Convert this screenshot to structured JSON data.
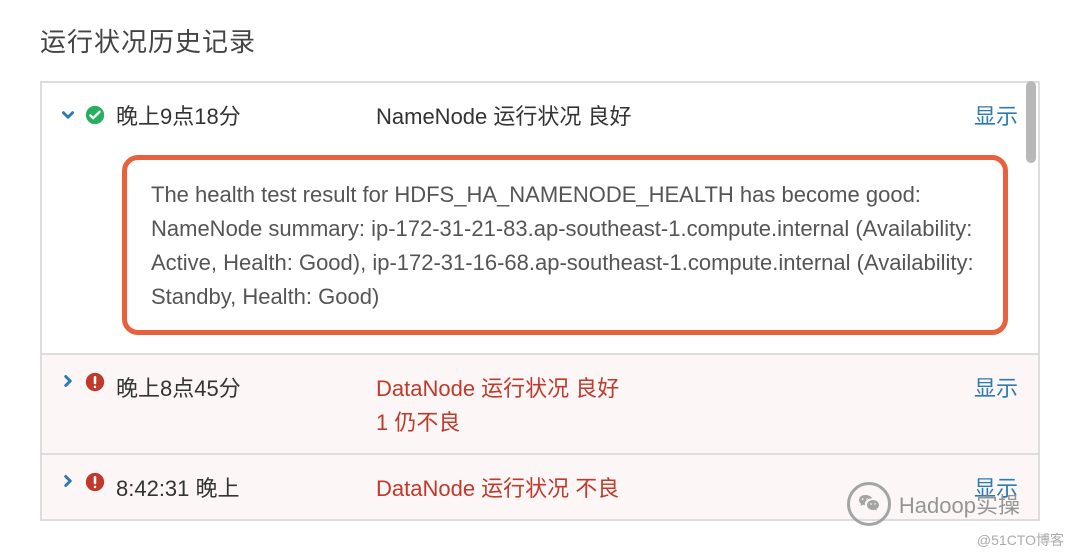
{
  "title": "运行状况历史记录",
  "rows": [
    {
      "time": "晚上9点18分",
      "status": "good",
      "msg": "NameNode 运行状况 良好",
      "action": "显示",
      "detail": "The health test result for HDFS_HA_NAMENODE_HEALTH has become good: NameNode summary: ip-172-31-21-83.ap-southeast-1.compute.internal (Availability: Active, Health: Good), ip-172-31-16-68.ap-southeast-1.compute.internal (Availability: Standby, Health: Good)"
    },
    {
      "time": "晚上8点45分",
      "status": "error",
      "msg": "DataNode 运行状况 良好",
      "msg2": "1 仍不良",
      "action": "显示"
    },
    {
      "time": "8:42:31 晚上",
      "status": "error",
      "msg": "DataNode 运行状况 不良",
      "action": "显示"
    }
  ],
  "watermark": {
    "brand": "Hadoop实操",
    "corner": "@51CTO博客"
  }
}
